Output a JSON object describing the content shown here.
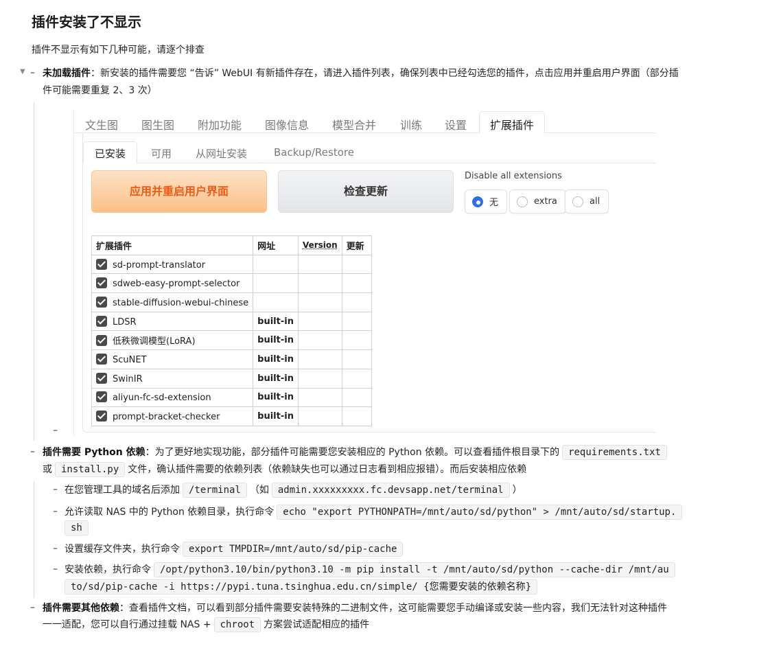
{
  "title": "插件安装了不显示",
  "intro": "插件不显示有如下几种可能，请逐个排查",
  "item1": {
    "label": "未加载插件",
    "text1": "：新安装的插件需要您 “告诉” WebUI 有新插件存在，请进入插件列表，确保列表中已经勾选您的插件，点击应用并重启用户界面（部分插",
    "text2": "件可能需要重复 2、3 次）"
  },
  "webui": {
    "tabs": [
      "文生图",
      "图生图",
      "附加功能",
      "图像信息",
      "模型合并",
      "训练",
      "设置",
      "扩展插件"
    ],
    "subtabs": [
      "已安装",
      "可用",
      "从网址安装",
      "Backup/Restore"
    ],
    "apply_button": "应用并重启用户界面",
    "check_button": "检查更新",
    "disable_label": "Disable all extensions",
    "radio_options": [
      "无",
      "extra",
      "all"
    ],
    "radio_selected": "无",
    "table_headers": [
      "扩展插件",
      "网址",
      "Version",
      "更新"
    ],
    "rows": [
      {
        "name": "sd-prompt-translator",
        "url": ""
      },
      {
        "name": "sdweb-easy-prompt-selector",
        "url": ""
      },
      {
        "name": "stable-diffusion-webui-chinese",
        "url": ""
      },
      {
        "name": "LDSR",
        "url": "built-in"
      },
      {
        "name": "低秩微调模型(LoRA)",
        "url": "built-in"
      },
      {
        "name": "ScuNET",
        "url": "built-in"
      },
      {
        "name": "SwinIR",
        "url": "built-in"
      },
      {
        "name": "aliyun-fc-sd-extension",
        "url": "built-in"
      },
      {
        "name": "prompt-bracket-checker",
        "url": "built-in"
      }
    ]
  },
  "item2": {
    "label": "插件需要 Python 依赖",
    "text1": "：为了更好地实现功能，部分插件可能需要您安装相应的 Python 依赖。可以查看插件根目录下的",
    "code1": "requirements.txt",
    "text2a": "或",
    "code2": "install.py",
    "text2b": "文件，确认插件需要的依赖列表（依赖缺失也可以通过日志看到相应报错）。而后安装相应依赖",
    "sub1_text": "在您管理工具的域名后添加",
    "sub1_code": "/terminal",
    "sub1_paren_open": "（如",
    "sub1_code2": "admin.xxxxxxxxx.fc.devsapp.net/terminal",
    "sub1_paren_close": "）",
    "sub2_text": "允许读取 NAS 中的 Python 依赖目录，执行命令",
    "sub2_code_a": "echo \"export PYTHONPATH=/mnt/auto/sd/python\" > /mnt/auto/sd/startup.",
    "sub2_code_b": "sh",
    "sub3_text": "设置缓存文件夹，执行命令",
    "sub3_code": "export TMPDIR=/mnt/auto/sd/pip-cache",
    "sub4_text": "安装依赖，执行命令",
    "sub4_code_a": "/opt/python3.10/bin/python3.10 -m pip install -t /mnt/auto/sd/python --cache-dir /mnt/au",
    "sub4_code_b": "to/sd/pip-cache -i https://pypi.tuna.tsinghua.edu.cn/simple/ {您需要安装的依赖名称}"
  },
  "item3": {
    "label": "插件需要其他依赖",
    "text1": "：查看插件文档，可以看到部分插件需要安装特殊的二进制文件，这可能需要您手动编译或安装一些内容，我们无法针对这种插件",
    "text2a": "一一适配，您可以自行通过挂载 NAS +",
    "code": "chroot",
    "text2b": "方案尝试适配相应的插件"
  }
}
